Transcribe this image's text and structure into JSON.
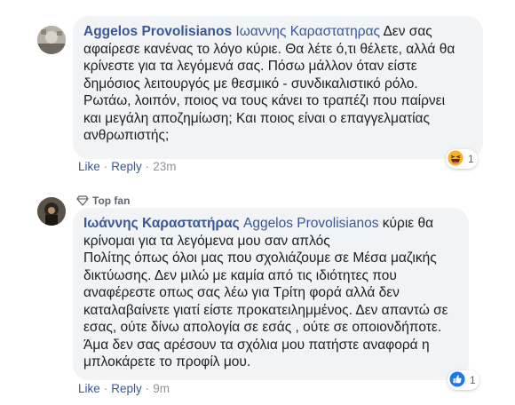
{
  "comments": [
    {
      "author": "Aggelos Provolisianos",
      "mention": "Ιωαννης Καραστατηρας",
      "lines": [
        " Δεν σας",
        "αφαίρεσε κανένας το λόγο κύριε. Θα λέτε ό,τι θέλετε, αλλά θα",
        "κρίνεστε για τα λεγόμενά σας. Πόσω μάλλον όταν είστε",
        "δημόσιος λειτουργός με θεσμικό - συνδικαλιστικό ρόλο.",
        "Ρωτάω, λοιπόν, ποιος να τους κάνει το τραπέζι που παίρνει",
        "και μεγάλη αποζημίωση; Και ποιος είναι ο επαγγελματίας",
        "ανθρωπιστής;"
      ],
      "actions": {
        "like": "Like",
        "reply": "Reply",
        "time": "23m"
      },
      "reaction": {
        "icon": "haha-icon",
        "count": "1"
      }
    },
    {
      "badge": "Top fan",
      "author": "Ιωάννης Καραστατήρας",
      "mention": "Aggelos Provolisianos",
      "lines": [
        " κύριε θα",
        "κρίνομαι για τα λεγόμενα μου σαν απλός",
        "Πολίτης όπως όλοι μας που σχολιάζουμε σε Μέσα μαζικής",
        "δικτύωσης. Δεν μιλώ με καμία από τις ιδιότητες που",
        "αναφέρεστε οπως σας λέω για Τρίτη φορά αλλά δεν",
        "καταλαβαίνετε γιατί είστε προκατειλημμένος. Δεν απαντώ σε",
        "εσας, ούτε δίνω απολογία σε εσάς , ούτε σε οποιονδήποτε.",
        "Άμα δεν σας αρέσουν τα σχόλια μου πατήστε αναφορά η",
        "μπλοκάρετε το προφίλ μου."
      ],
      "actions": {
        "like": "Like",
        "reply": "Reply",
        "time": "9m"
      },
      "reaction": {
        "icon": "like-icon",
        "count": "1"
      }
    }
  ],
  "colors": {
    "name_link": "#385898",
    "bubble_bg": "#f2f3f5",
    "muted": "#90949c",
    "like_blue": "#1877f2",
    "haha_yellow": "#f7b125"
  }
}
